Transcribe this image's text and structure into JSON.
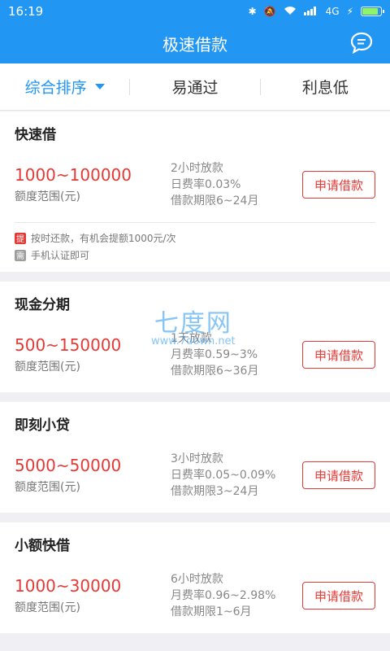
{
  "status_bar": {
    "time": "16:19",
    "network": "4G",
    "colors": {
      "bar": "#2196f3",
      "battery": "#8cf36a"
    },
    "battery_level": 0.85
  },
  "app_bar": {
    "title": "极速借款",
    "message_icon": "chat-bubble-icon"
  },
  "sort_tabs": [
    {
      "label": "综合排序",
      "active": true
    },
    {
      "label": "易通过",
      "active": false
    },
    {
      "label": "利息低",
      "active": false
    }
  ],
  "amount_label": "额度范围(元)",
  "apply_label": "申请借款",
  "loans": [
    {
      "name": "快速借",
      "amount": "1000~100000",
      "speed": "2小时放款",
      "rate": "日费率0.03%",
      "term": "借款期限6~24月",
      "tips": [
        {
          "tag": "提",
          "text": "按时还款，有机会提额1000元/次",
          "color": "red"
        },
        {
          "tag": "需",
          "text": "手机认证即可",
          "color": "gray"
        }
      ]
    },
    {
      "name": "现金分期",
      "amount": "500~150000",
      "speed": "1天放款",
      "rate": "月费率0.59~3%",
      "term": "借款期限6~36月"
    },
    {
      "name": "即刻小贷",
      "amount": "5000~50000",
      "speed": "3小时放款",
      "rate": "日费率0.05~0.09%",
      "term": "借款期限3~24月"
    },
    {
      "name": "小额快借",
      "amount": "1000~30000",
      "speed": "6小时放款",
      "rate": "月费率0.96~2.98%",
      "term": "借款期限1~6月"
    }
  ],
  "watermark": {
    "line1": "七度网",
    "line2": "www.7down.net"
  }
}
